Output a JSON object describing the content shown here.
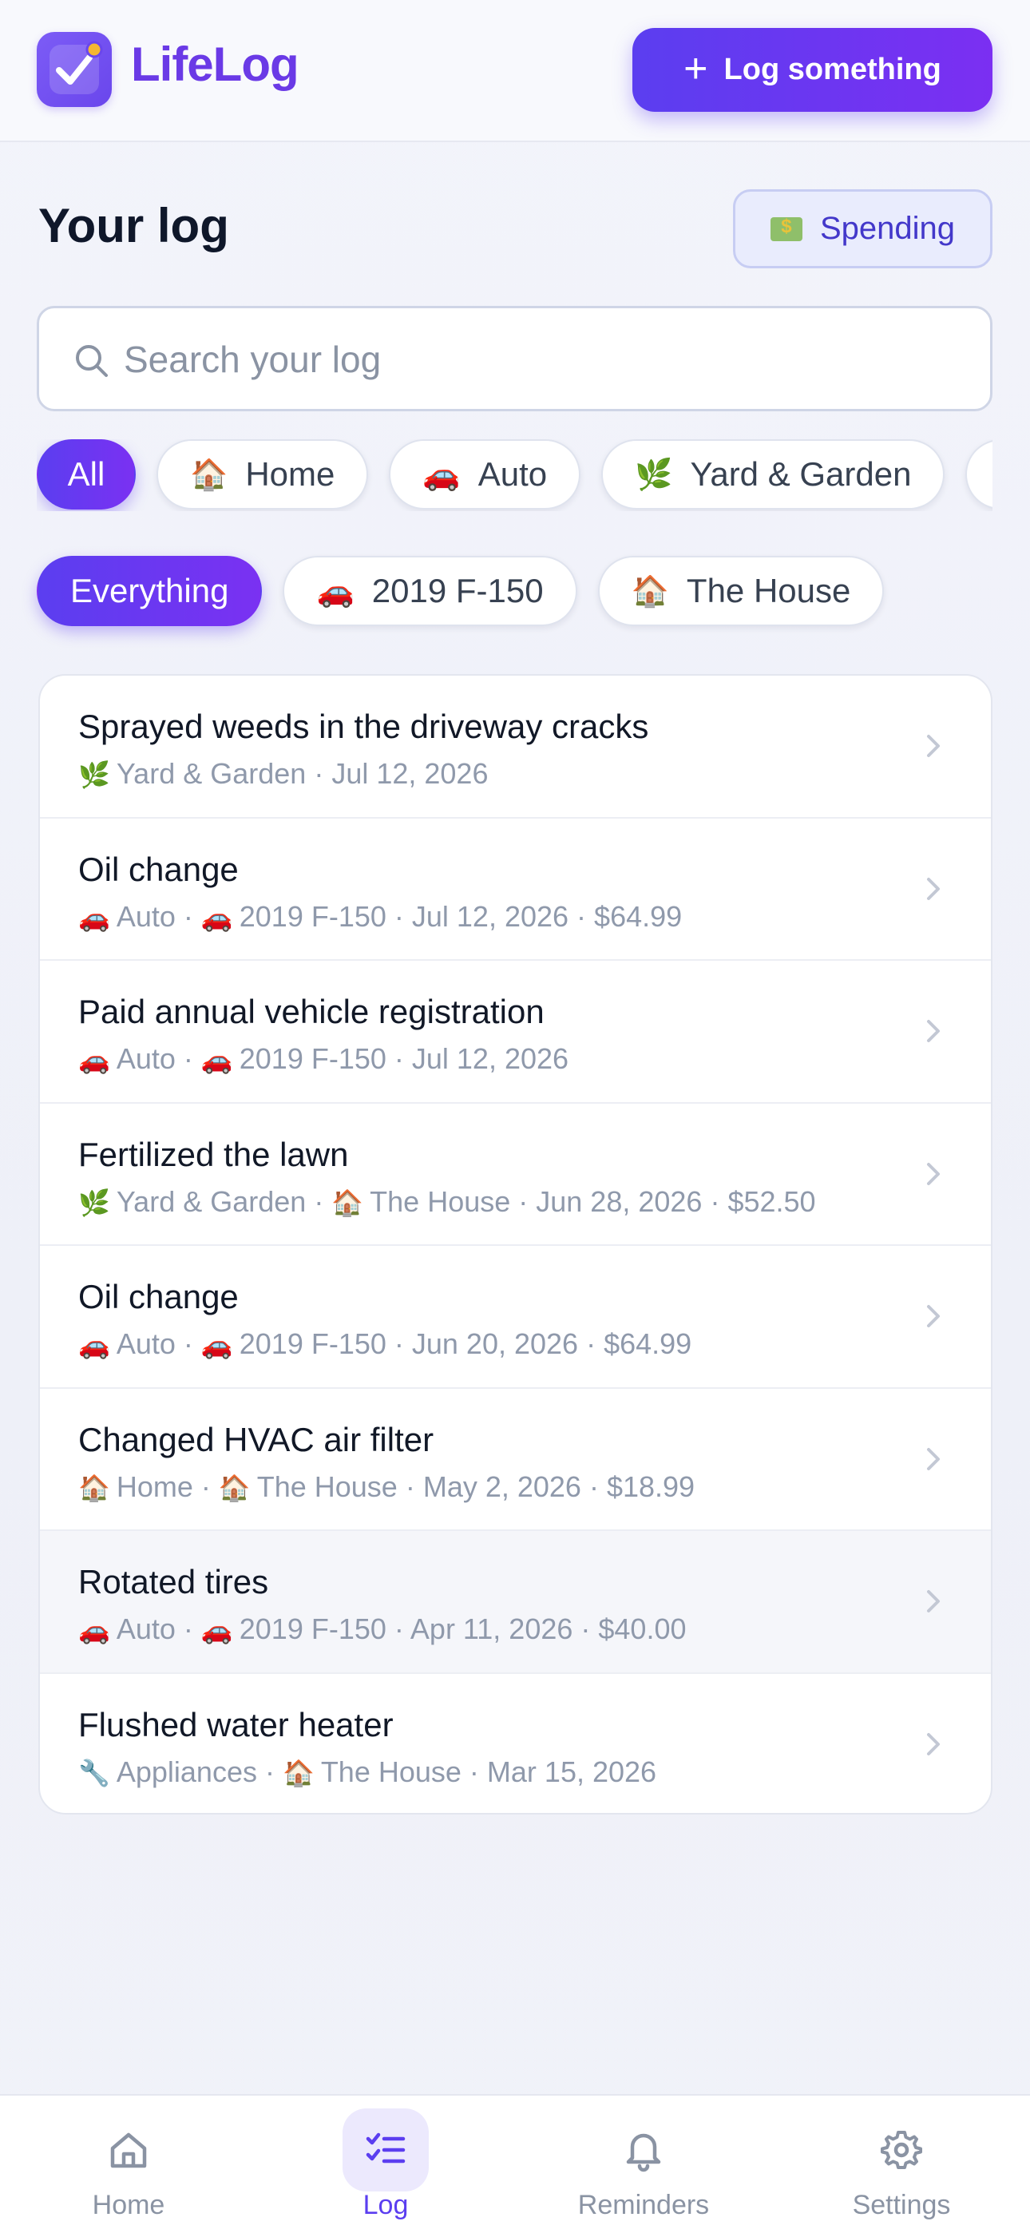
{
  "header": {
    "app_name": "LifeLog",
    "log_button_label": "Log something",
    "accent": "#5b3ef0"
  },
  "page": {
    "title": "Your log",
    "spending_label": "Spending",
    "spending_icon": "money-icon"
  },
  "search": {
    "placeholder": "Search your log",
    "value": ""
  },
  "category_filters": [
    {
      "label": "All",
      "icon": "",
      "active": true
    },
    {
      "label": "Home",
      "icon": "🏠",
      "active": false
    },
    {
      "label": "Auto",
      "icon": "🚗",
      "active": false
    },
    {
      "label": "Yard & Garden",
      "icon": "🌿",
      "active": false
    },
    {
      "label": "",
      "icon": "🔧",
      "active": false
    }
  ],
  "asset_filters": [
    {
      "label": "Everything",
      "icon": "",
      "active": true
    },
    {
      "label": "2019 F-150",
      "icon": "🚗",
      "active": false
    },
    {
      "label": "The House",
      "icon": "🏠",
      "active": false
    }
  ],
  "entries": [
    {
      "title": "Sprayed weeds in the driveway cracks",
      "cat_icon": "🌿",
      "category": "Yard & Garden",
      "asset_icon": "",
      "asset": "",
      "date": "Jul 12, 2026",
      "amount": ""
    },
    {
      "title": "Oil change",
      "cat_icon": "🚗",
      "category": "Auto",
      "asset_icon": "🚗",
      "asset": "2019 F-150",
      "date": "Jul 12, 2026",
      "amount": "$64.99"
    },
    {
      "title": "Paid annual vehicle registration",
      "cat_icon": "🚗",
      "category": "Auto",
      "asset_icon": "🚗",
      "asset": "2019 F-150",
      "date": "Jul 12, 2026",
      "amount": ""
    },
    {
      "title": "Fertilized the lawn",
      "cat_icon": "🌿",
      "category": "Yard & Garden",
      "asset_icon": "🏠",
      "asset": "The House",
      "date": "Jun 28, 2026",
      "amount": "$52.50"
    },
    {
      "title": "Oil change",
      "cat_icon": "🚗",
      "category": "Auto",
      "asset_icon": "🚗",
      "asset": "2019 F-150",
      "date": "Jun 20, 2026",
      "amount": "$64.99"
    },
    {
      "title": "Changed HVAC air filter",
      "cat_icon": "🏠",
      "category": "Home",
      "asset_icon": "🏠",
      "asset": "The House",
      "date": "May 2, 2026",
      "amount": "$18.99"
    },
    {
      "title": "Rotated tires",
      "cat_icon": "🚗",
      "category": "Auto",
      "asset_icon": "🚗",
      "asset": "2019 F-150",
      "date": "Apr 11, 2026",
      "amount": "$40.00"
    },
    {
      "title": "Flushed water heater",
      "cat_icon": "🔧",
      "category": "Appliances",
      "asset_icon": "🏠",
      "asset": "The House",
      "date": "Mar 15, 2026",
      "amount": ""
    }
  ],
  "nav": [
    {
      "label": "Home",
      "icon": "home-icon",
      "active": false
    },
    {
      "label": "Log",
      "icon": "checklist-icon",
      "active": true
    },
    {
      "label": "Reminders",
      "icon": "bell-icon",
      "active": false
    },
    {
      "label": "Settings",
      "icon": "gear-icon",
      "active": false
    }
  ]
}
